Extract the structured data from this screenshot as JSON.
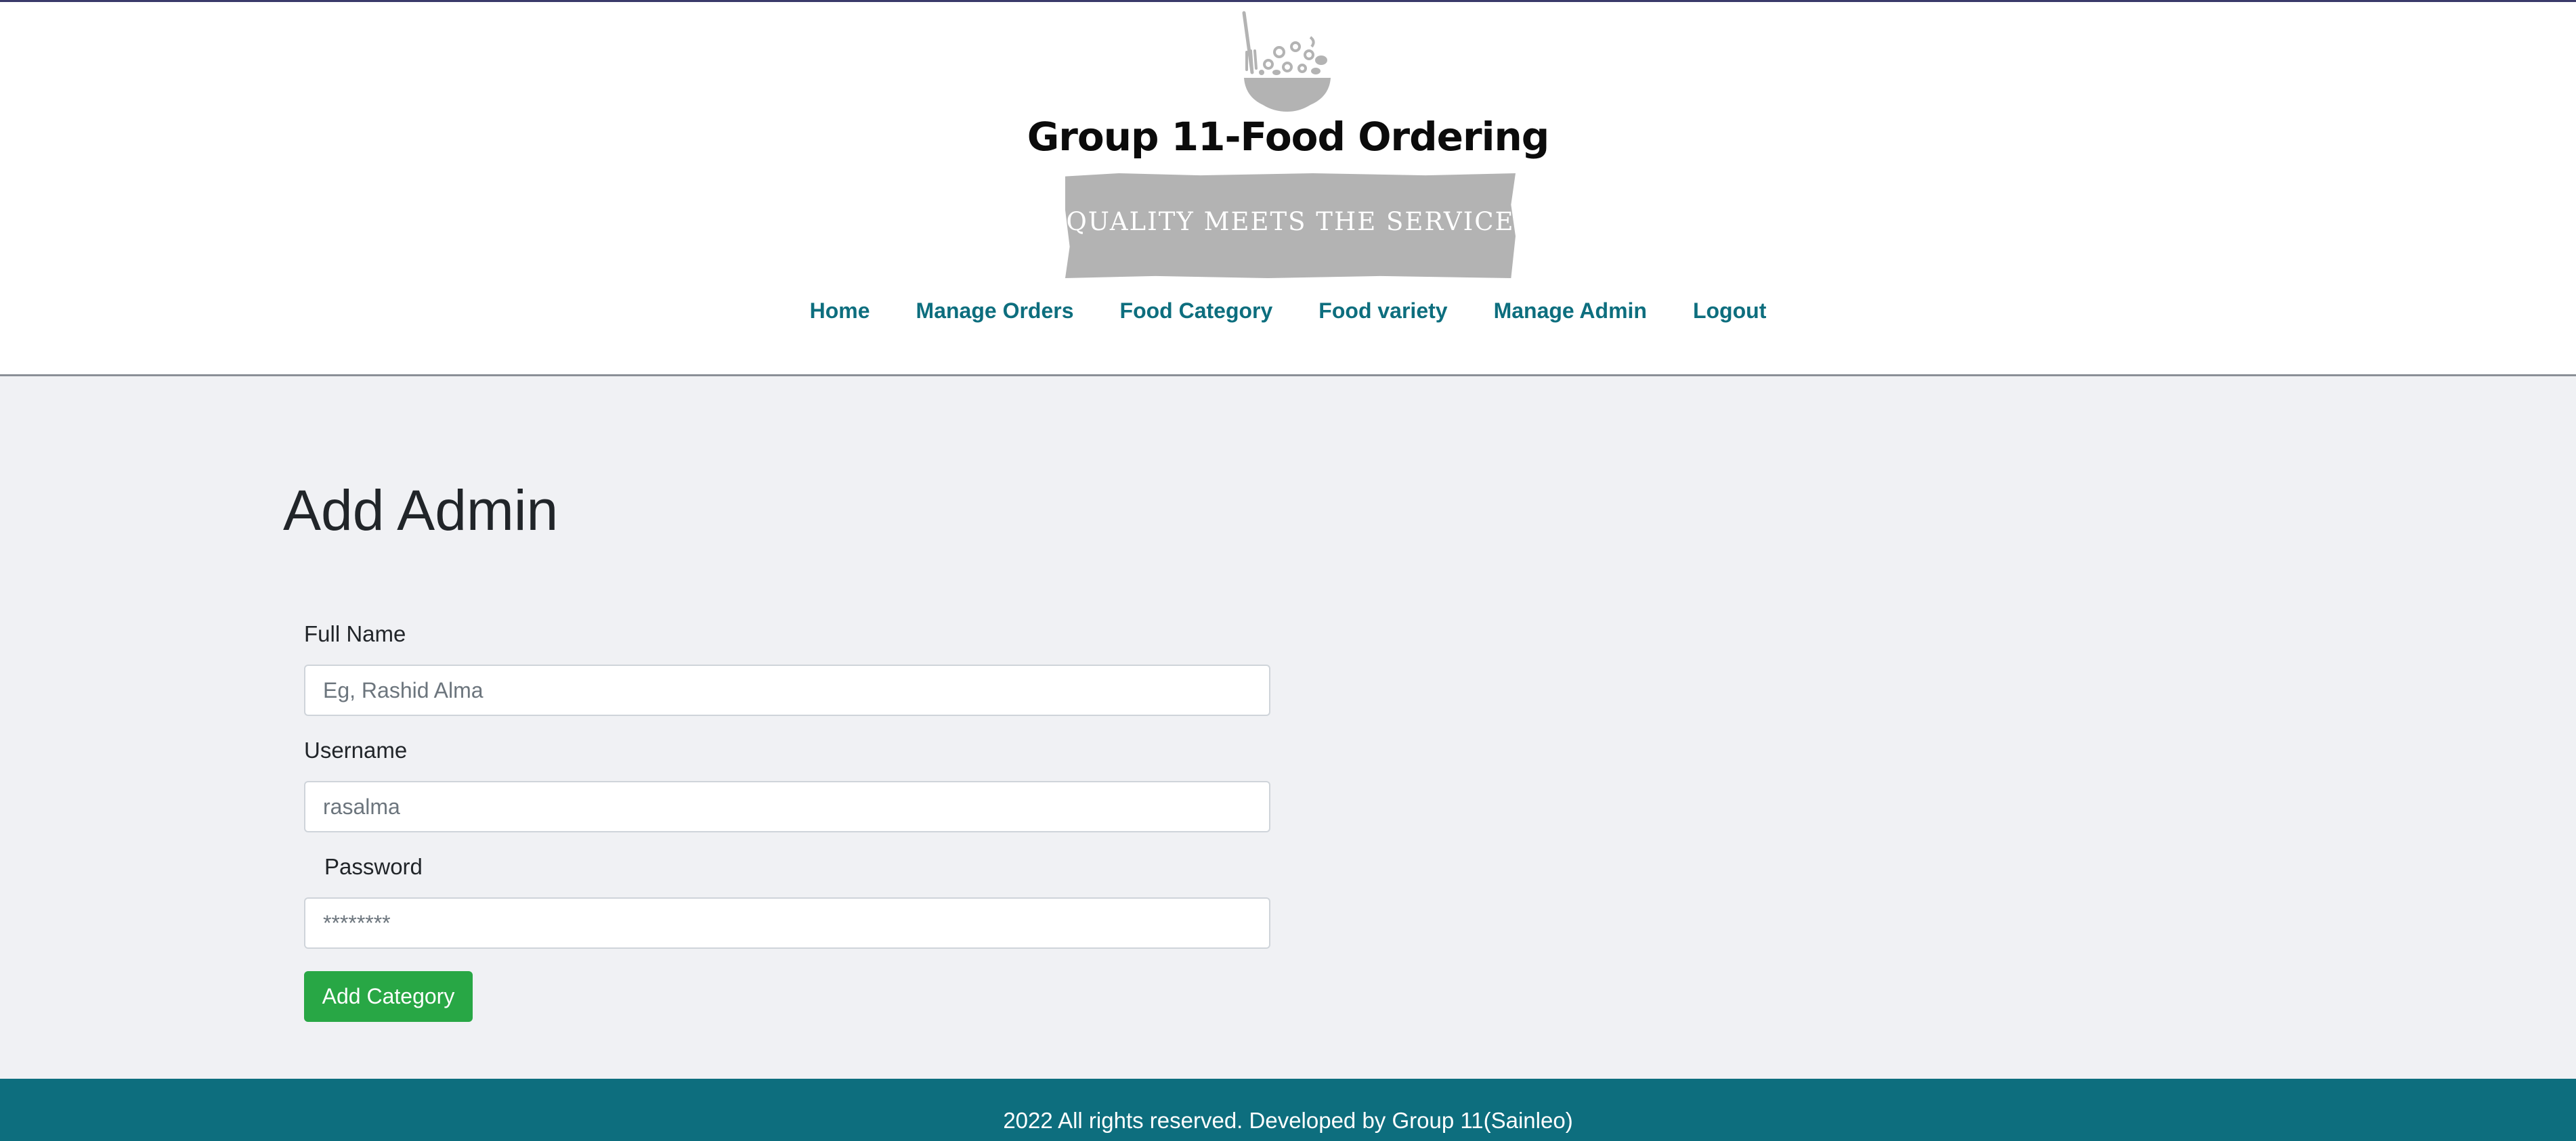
{
  "brand": {
    "title": "Group 11-Food Ordering",
    "tagline": "QUALITY MEETS THE SERVICE",
    "logo_icon": "bowl-with-fork-icon"
  },
  "nav": {
    "items": [
      {
        "label": "Home"
      },
      {
        "label": "Manage Orders"
      },
      {
        "label": "Food Category"
      },
      {
        "label": "Food variety"
      },
      {
        "label": "Manage Admin"
      },
      {
        "label": "Logout"
      }
    ]
  },
  "page": {
    "heading": "Add Admin"
  },
  "form": {
    "full_name": {
      "label": "Full Name",
      "placeholder": "Eg, Rashid Alma",
      "value": ""
    },
    "username": {
      "label": "Username",
      "placeholder": "rasalma",
      "value": ""
    },
    "password": {
      "label": "Password",
      "placeholder": "********",
      "value": ""
    },
    "submit_label": "Add Category"
  },
  "footer": {
    "text": "2022 All rights reserved. Developed by Group 11(Sainleo)"
  },
  "colors": {
    "accent": "#0d6e7e",
    "button": "#28a745",
    "background": "#f0f1f4",
    "tagline_bg": "#b3b3b3"
  }
}
